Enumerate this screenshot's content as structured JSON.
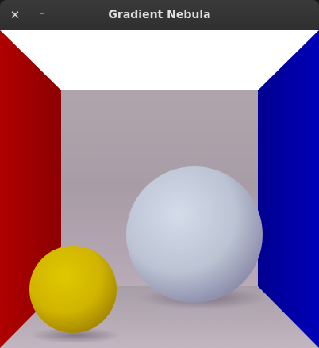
{
  "window": {
    "title": "Gradient Nebula",
    "close_glyph": "✕",
    "minimize_glyph": "–"
  },
  "scene": {
    "colors": {
      "ceiling": "#ffffff",
      "left_wall": "#a80000",
      "right_wall": "#0000b0",
      "back_wall": "#a89ca4",
      "floor": "#b4a8b4",
      "large_sphere": "#c8d2e2",
      "small_sphere": "#d8c000"
    }
  }
}
